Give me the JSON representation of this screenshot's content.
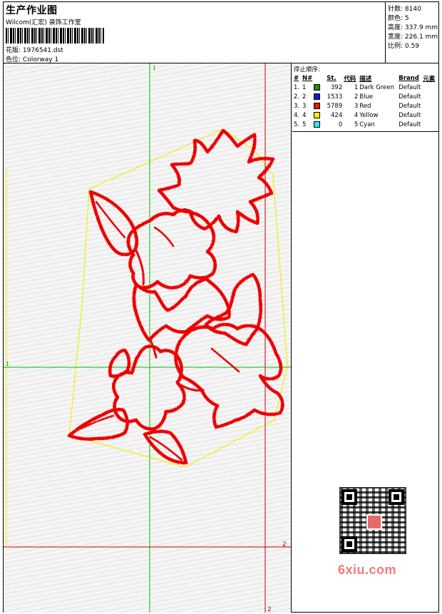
{
  "header": {
    "title": "生产作业图",
    "studio": "Wilcom(汇宏) 装饰工作室",
    "design_label": "花版:",
    "design_file": "1976541.dst",
    "colorway_label": "色位:",
    "colorway": "Colorway 1"
  },
  "stats": [
    {
      "label": "针数:",
      "value": "8140"
    },
    {
      "label": "颜色:",
      "value": "5"
    },
    {
      "label": "高度:",
      "value": "337.9 mm"
    },
    {
      "label": "宽度:",
      "value": "226.1 mm"
    },
    {
      "label": "比例:",
      "value": "0.59"
    }
  ],
  "stop_sequence": {
    "title": "停止顺序:",
    "headers": [
      "#",
      "N#",
      "",
      "St.",
      "代码",
      "描述",
      "Brand",
      "元素"
    ],
    "rows": [
      {
        "idx": "1.",
        "n": "1",
        "color": "#1e8a1e",
        "st": "392",
        "code": "1",
        "desc": "Dark Green",
        "brand": "Default"
      },
      {
        "idx": "2.",
        "n": "2",
        "color": "#1414e6",
        "st": "1533",
        "code": "2",
        "desc": "Blue",
        "brand": "Default"
      },
      {
        "idx": "3.",
        "n": "3",
        "color": "#e61414",
        "st": "5789",
        "code": "3",
        "desc": "Red",
        "brand": "Default"
      },
      {
        "idx": "4.",
        "n": "4",
        "color": "#f2f200",
        "st": "424",
        "code": "4",
        "desc": "Yellow",
        "brand": "Default"
      },
      {
        "idx": "5.",
        "n": "5",
        "color": "#2ee6e6",
        "st": "0",
        "code": "5",
        "desc": "Cyan",
        "brand": "Default"
      }
    ]
  },
  "canvas": {
    "guide_labels": {
      "top_green": "1",
      "left_green": "1",
      "right_red": "2",
      "bottom_red": "2"
    },
    "colors": {
      "outline": "#ee0000",
      "boundary": "#f0f000",
      "guide_green": "#00c000",
      "guide_red": "#cc0000",
      "guide_yellow": "#f0f000"
    }
  },
  "watermark": {
    "text": "6xiu.com"
  }
}
